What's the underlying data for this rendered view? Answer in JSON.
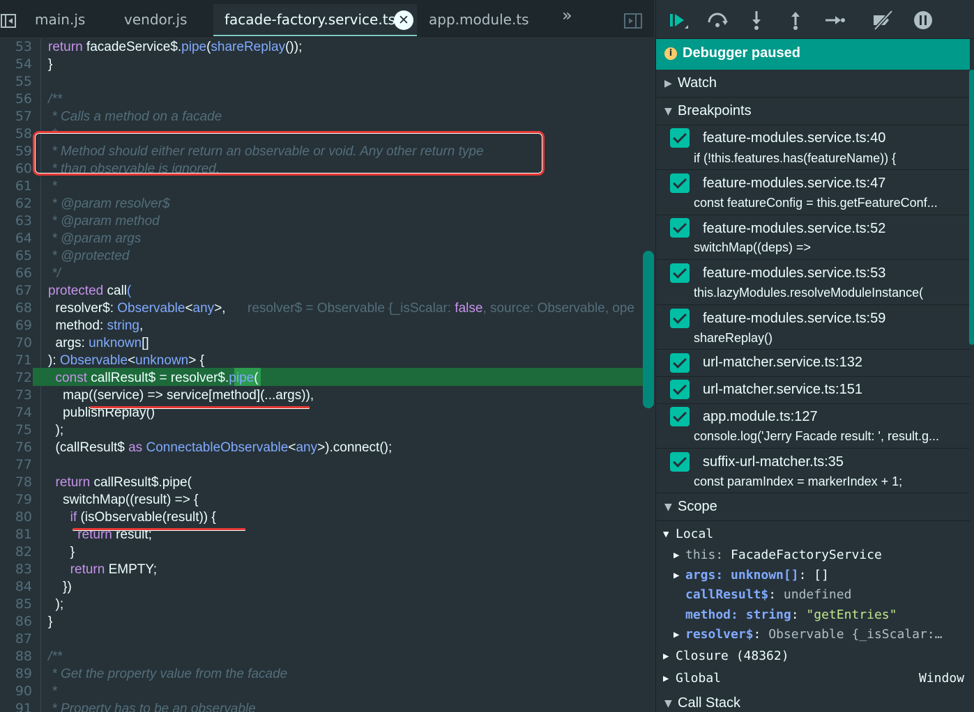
{
  "tabs": [
    {
      "label": "main.js"
    },
    {
      "label": "vendor.js"
    },
    {
      "label": "facade-factory.service.ts"
    },
    {
      "label": "app.module.ts"
    }
  ],
  "tab_close": "✕",
  "tab_more": "»",
  "code": {
    "lines": {
      "53": "53",
      "54": "54",
      "55": "55",
      "56": "56",
      "57": "57",
      "58": "58",
      "59": "59",
      "60": "60",
      "61": "61",
      "62": "62",
      "63": "63",
      "64": "64",
      "65": "65",
      "66": "66",
      "67": "67",
      "68": "68",
      "69": "69",
      "70": "70",
      "71": "71",
      "72": "72",
      "73": "73",
      "74": "74",
      "75": "75",
      "76": "76",
      "77": "77",
      "78": "78",
      "79": "79",
      "80": "80",
      "81": "81",
      "82": "82",
      "83": "83",
      "84": "84",
      "85": "85",
      "86": "86",
      "87": "87",
      "88": "88",
      "89": "89",
      "90": "90",
      "91": "91"
    },
    "l53": {
      "kw": "return",
      "a": " facadeService$.",
      "fn": "pipe",
      "b": "(",
      "fn2": "shareReplay",
      "c": "());"
    },
    "l54": "}",
    "l56": "/**",
    "l57": " * Calls a method on a facade",
    "l58": " *",
    "l59": " * Method should either return an observable or void. Any other return type",
    "l60": " * than observable is ignored.",
    "l61": " *",
    "l62": " * @param resolver$",
    "l63": " * @param method",
    "l64": " * @param args",
    "l65": " * @protected",
    "l66": " */",
    "l67": {
      "kw": "protected",
      "fn": " call",
      "b": "("
    },
    "l68": {
      "a": "  resolver$",
      "b": ": ",
      "ty": "Observable",
      "c": "<",
      "ty2": "any",
      "d": ">,"
    },
    "l68_inline": {
      "a": "resolver$ = Observable {_isScalar: ",
      "kw": "false",
      "b": ", source: Observable, ope"
    },
    "l69": {
      "a": "  method",
      "b": ": ",
      "ty": "string",
      "c": ","
    },
    "l70": {
      "a": "  args",
      "b": ": ",
      "ty": "unknown",
      "c": "[]"
    },
    "l71": {
      "a": "): ",
      "ty": "Observable",
      "b": "<",
      "ty2": "unknown",
      "c": "> {"
    },
    "l72": {
      "kw": "  const",
      "a": " callResult$ = resolver$.",
      "fn": "pipe",
      "b": "("
    },
    "l73": {
      "fn": "    map",
      "a": "((service) => service[method](...args)),"
    },
    "l74": {
      "fn": "    publishReplay",
      "a": "()"
    },
    "l75": "  );",
    "l76": {
      "a": "  (callResult$ ",
      "kw": "as",
      "ty": " ConnectableObservable",
      "b": "<",
      "ty2": "any",
      "c": ">).",
      "fn": "connect",
      "d": "();"
    },
    "l78": {
      "kw": "  return",
      "a": " callResult$.",
      "fn": "pipe",
      "b": "("
    },
    "l79": {
      "fn": "    switchMap",
      "a": "((result) => {"
    },
    "l80": {
      "kw": "      if",
      "a": " (",
      "fn": "isObservable",
      "b": "(result)) {"
    },
    "l81": {
      "kw": "        return",
      "a": " result;"
    },
    "l82": "      }",
    "l83": {
      "kw": "      return",
      "a": " EMPTY;"
    },
    "l84": "    })",
    "l85": "  );",
    "l86": "}",
    "l88": "/**",
    "l89": " * Get the property value from the facade",
    "l90": " *",
    "l91": " * Property has to be an observable"
  },
  "debugger": {
    "paused_label": "Debugger paused",
    "sections": {
      "watch": "Watch",
      "breakpoints": "Breakpoints",
      "scope": "Scope",
      "callstack": "Call Stack"
    },
    "breakpoints": [
      {
        "title": "feature-modules.service.ts:40",
        "code": "if (!this.features.has(featureName)) {",
        "checked": true
      },
      {
        "title": "feature-modules.service.ts:47",
        "code": "const featureConfig = this.getFeatureConf...",
        "checked": true
      },
      {
        "title": "feature-modules.service.ts:52",
        "code": "switchMap((deps) =>",
        "checked": true
      },
      {
        "title": "feature-modules.service.ts:53",
        "code": "this.lazyModules.resolveModuleInstance(",
        "checked": true
      },
      {
        "title": "feature-modules.service.ts:59",
        "code": "shareReplay()",
        "checked": true
      },
      {
        "title": "url-matcher.service.ts:132",
        "code": "",
        "checked": true
      },
      {
        "title": "url-matcher.service.ts:151",
        "code": "",
        "checked": true
      },
      {
        "title": "app.module.ts:127",
        "code": "console.log('Jerry Facade result: ', result.g...",
        "checked": true
      },
      {
        "title": "suffix-url-matcher.ts:35",
        "code": "const paramIndex = markerIndex + 1;",
        "checked": true
      }
    ],
    "scope": {
      "local_label": "Local",
      "this": {
        "key": "this",
        "value": "FacadeFactoryService"
      },
      "args": {
        "key": "args: unknown[]",
        "value": "[]"
      },
      "callResult": {
        "key": "callResult$",
        "value": "undefined"
      },
      "method": {
        "key": "method: string",
        "value": "\"getEntries\""
      },
      "resolver": {
        "key": "resolver$",
        "value": "Observable {_isScalar:…"
      },
      "closure_label": "Closure (48362)",
      "global_label": "Global",
      "global_value": "Window"
    }
  },
  "colors": {
    "accent": "#009a8a",
    "checkbox": "#00bfa5",
    "exec_line": "#1d6a3a",
    "annotation": "#e53935"
  }
}
